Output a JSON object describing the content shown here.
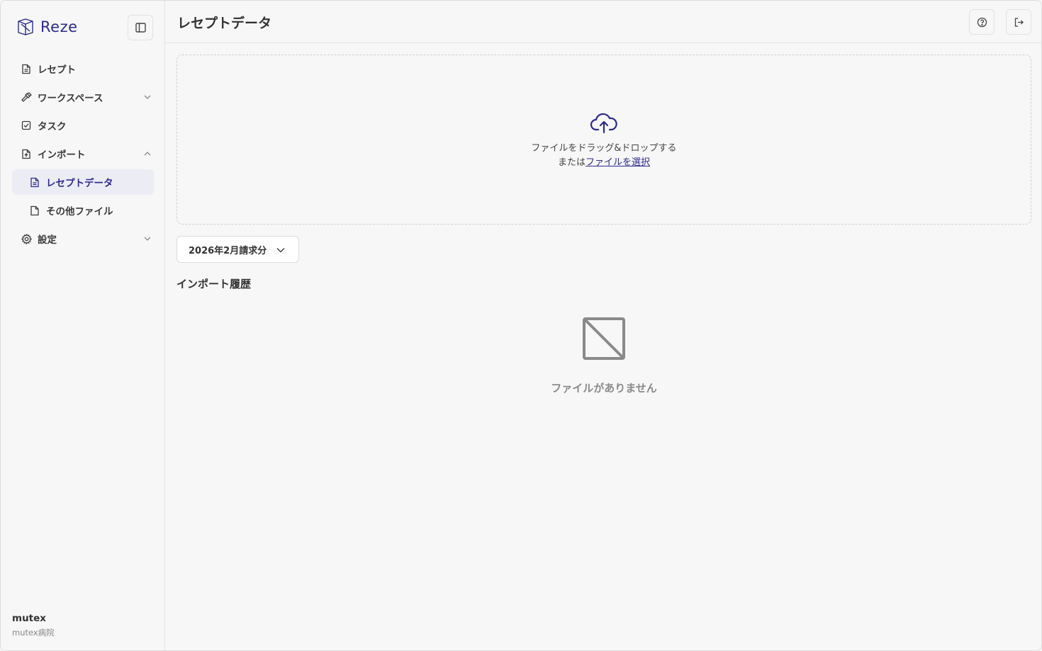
{
  "brand": {
    "name": "Reze",
    "accent": "#2e2a8c"
  },
  "sidebar": {
    "items": [
      {
        "label": "レセプト",
        "icon": "document-icon"
      },
      {
        "label": "ワークスペース",
        "icon": "hammer-icon",
        "expanded": false
      },
      {
        "label": "タスク",
        "icon": "checkbox-icon"
      },
      {
        "label": "インポート",
        "icon": "file-import-icon",
        "expanded": true
      },
      {
        "label": "レセプトデータ",
        "icon": "document-icon",
        "active": true
      },
      {
        "label": "その他ファイル",
        "icon": "file-icon"
      },
      {
        "label": "設定",
        "icon": "gear-icon",
        "expanded": false
      }
    ],
    "user": {
      "name": "mutex",
      "org": "mutex病院"
    }
  },
  "header": {
    "title": "レセプトデータ"
  },
  "dropzone": {
    "line1": "ファイルをドラッグ&ドロップする",
    "line2_prefix": "または",
    "line2_link": "ファイルを選択"
  },
  "period": {
    "selected": "2026年2月請求分"
  },
  "history": {
    "title": "インポート履歴",
    "empty_text": "ファイルがありません"
  }
}
